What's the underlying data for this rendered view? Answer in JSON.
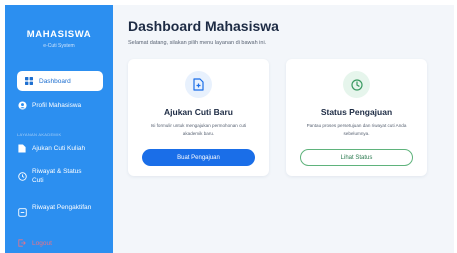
{
  "sidebar": {
    "brand_title": "MAHASISWA",
    "brand_subtitle": "e-Cuti System",
    "section_label": "LAYANAN AKADEMIK",
    "items": [
      {
        "label": "Dashboard",
        "icon": "grid-icon",
        "active": true
      },
      {
        "label": "Profil Mahasiswa",
        "icon": "user-circle-icon",
        "active": false
      },
      {
        "label": "Ajukan Cuti Kuliah",
        "icon": "document-icon",
        "active": false
      },
      {
        "label": "Riwayat & Status Cuti",
        "icon": "clock-icon",
        "active": false
      },
      {
        "label": "Riwayat Pengaktifan",
        "icon": "checklist-icon",
        "active": false
      },
      {
        "label": "Logout",
        "icon": "logout-icon",
        "active": false
      }
    ]
  },
  "main": {
    "title": "Dashboard Mahasiswa",
    "subtitle": "Selamat datang, silakan pilih menu layanan di bawah ini.",
    "cards": [
      {
        "title": "Ajukan Cuti Baru",
        "description": "Isi formulir untuk mengajukan permohonan cuti akademik baru.",
        "button": "Buat Pengajuan",
        "icon": "file-plus-icon"
      },
      {
        "title": "Status Pengajuan",
        "description": "Pantau proses persetujuan dan riwayat cuti Anda sebelumnya.",
        "button": "Lihat Status",
        "icon": "clock-icon"
      }
    ]
  },
  "colors": {
    "sidebar": "#2c8ff0",
    "primary_button": "#1a6ee8",
    "status_green": "#5fb37c",
    "background": "#f3f6fa"
  }
}
